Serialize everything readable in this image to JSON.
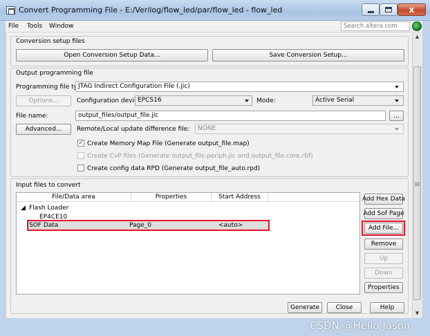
{
  "window": {
    "title": "Convert Programming File - E:/Verilog/flow_led/par/flow_led - flow_led",
    "min_button": "minimize",
    "max_button": "maximize",
    "close_label": "x"
  },
  "menu": {
    "file": "File",
    "tools": "Tools",
    "window": "Window",
    "search_placeholder": "Search altera.com"
  },
  "conversion_setup": {
    "title": "Conversion setup files",
    "open_button": "Open Conversion Setup Data...",
    "save_button": "Save Conversion Setup..."
  },
  "output": {
    "title": "Output programming file",
    "type_label": "Programming file type:",
    "type_value": "JTAG Indirect Configuration File (.jic)",
    "options_button": "Options...",
    "config_device_label": "Configuration device:",
    "config_device_value": "EPCS16",
    "mode_label": "Mode:",
    "mode_value": "Active Serial",
    "file_name_label": "File name:",
    "file_name_value": "output_files/output_file.jic",
    "browse_button": "...",
    "advanced_button": "Advanced...",
    "remote_label": "Remote/Local update difference file:",
    "remote_value": "NONE",
    "checkbox_map": "Create Memory Map File (Generate output_file.map)",
    "checkbox_cvp": "Create CvP files (Generate output_file.periph.jic and output_file.core.rbf)",
    "checkbox_rpd": "Create config data RPD (Generate output_file_auto.rpd)",
    "map_checked": true,
    "cvp_checked": false,
    "rpd_checked": false
  },
  "input_files": {
    "title": "Input files to convert",
    "columns": [
      "File/Data area",
      "Properties",
      "Start Address"
    ],
    "flash_loader": "Flash Loader",
    "device": "EP4CE10",
    "sof_row": {
      "name": "SOF Data",
      "properties": "Page_0",
      "start_address": "<auto>"
    },
    "buttons": {
      "add_hex": "Add Hex Data",
      "add_sof": "Add Sof Page",
      "add_file": "Add File...",
      "remove": "Remove",
      "up": "Up",
      "down": "Down",
      "properties": "Properties"
    }
  },
  "footer": {
    "generate": "Generate",
    "close": "Close",
    "help": "Help"
  },
  "watermark": "CSDN @Hello Jason"
}
